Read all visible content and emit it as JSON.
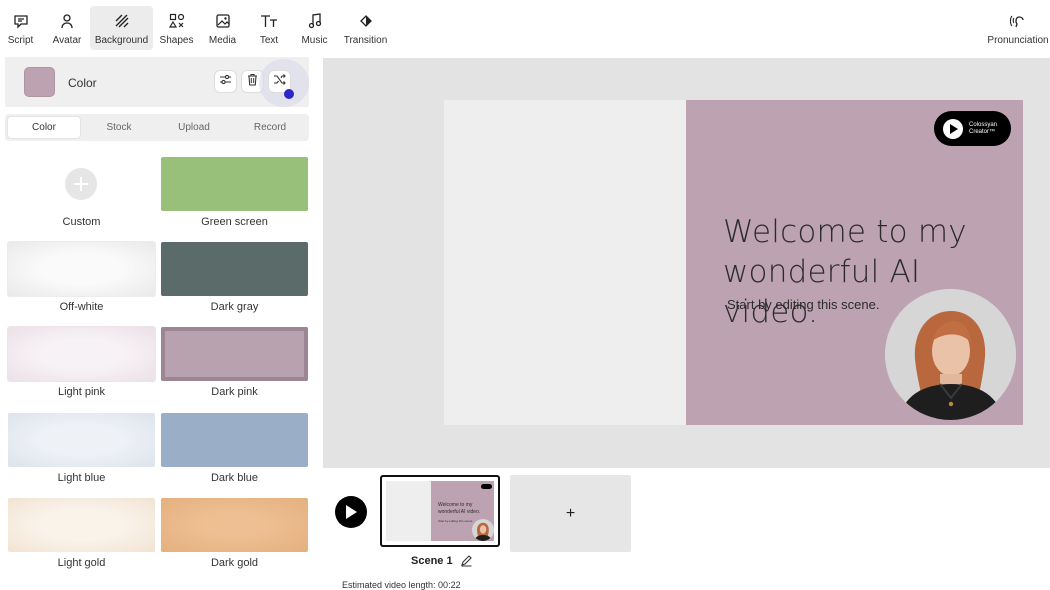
{
  "toolbar": {
    "items": [
      {
        "label": "Script",
        "icon": "script-icon"
      },
      {
        "label": "Avatar",
        "icon": "avatar-icon"
      },
      {
        "label": "Background",
        "icon": "background-icon",
        "active": true
      },
      {
        "label": "Shapes",
        "icon": "shapes-icon"
      },
      {
        "label": "Media",
        "icon": "media-icon"
      },
      {
        "label": "Text",
        "icon": "text-icon"
      },
      {
        "label": "Music",
        "icon": "music-icon"
      },
      {
        "label": "Transition",
        "icon": "transition-icon"
      }
    ],
    "pronunciation": "Pronunciation"
  },
  "panel": {
    "title": "Color",
    "selected_color": "#bda3b1",
    "actions": [
      "adjust-icon",
      "trash-icon",
      "shuffle-icon"
    ]
  },
  "tabs": [
    "Color",
    "Stock",
    "Upload",
    "Record"
  ],
  "active_tab": "Color",
  "swatches": [
    {
      "label": "Custom",
      "color": "#ffffff"
    },
    {
      "label": "Green screen",
      "color": "#98c07b"
    },
    {
      "label": "Off-white",
      "color": "#f0f0f0"
    },
    {
      "label": "Dark gray",
      "color": "#5a6b69"
    },
    {
      "label": "Light pink",
      "color": "#efe6ec"
    },
    {
      "label": "Dark pink",
      "color": "#b9a2b0"
    },
    {
      "label": "Light blue",
      "color": "#e3e8ef"
    },
    {
      "label": "Dark blue",
      "color": "#9aaec7"
    },
    {
      "label": "Light gold",
      "color": "#f5e9dc"
    },
    {
      "label": "Dark gold",
      "color": "#e8b98b"
    }
  ],
  "slide": {
    "logo_line1": "Colossyan",
    "logo_line2": "Creator™",
    "headline_1": "Welcome to my",
    "headline_2": "wonderful AI video.",
    "subline": "Start by editing this scene."
  },
  "timeline": {
    "scene_label": "Scene 1",
    "thumb_headline_1": "Welcome to my",
    "thumb_headline_2": "wonderful AI video.",
    "thumb_subline": "Start by editing this scene.",
    "add_label": "+",
    "estimate": "Estimated video length: 00:22"
  }
}
